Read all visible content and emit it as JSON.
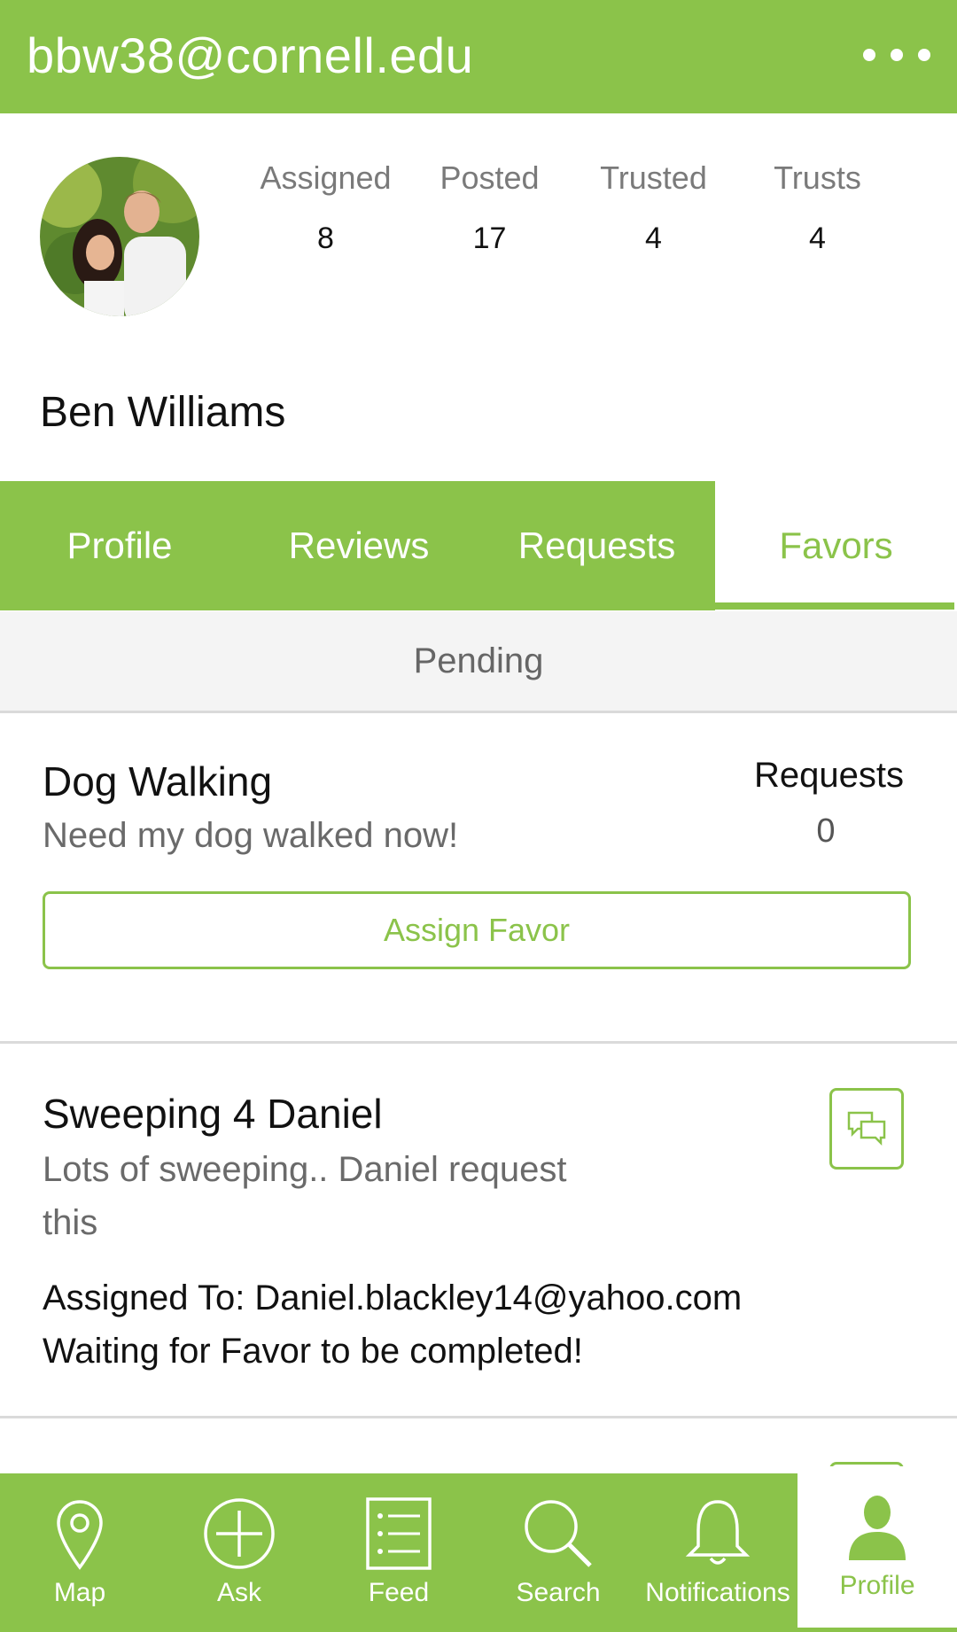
{
  "header": {
    "title": "bbw38@cornell.edu",
    "menu_icon": "more-dots-icon"
  },
  "profile": {
    "name": "Ben Williams",
    "stats": [
      {
        "label": "Assigned",
        "value": "8"
      },
      {
        "label": "Posted",
        "value": "17"
      },
      {
        "label": "Trusted",
        "value": "4"
      },
      {
        "label": "Trusts",
        "value": "4"
      }
    ]
  },
  "tabs": [
    {
      "label": "Profile"
    },
    {
      "label": "Reviews"
    },
    {
      "label": "Requests"
    },
    {
      "label": "Favors",
      "active": true
    }
  ],
  "section": {
    "title": "Pending"
  },
  "favors": [
    {
      "title": "Dog Walking",
      "description": "Need my dog walked now!",
      "requests_label": "Requests",
      "requests_count": "0",
      "button_label": "Assign Favor"
    },
    {
      "title": "Sweeping 4 Daniel",
      "description_line1": "Lots of sweeping.. Daniel request",
      "description_line2": "this",
      "assigned_to": "Assigned To: Daniel.blackley14@yahoo.com",
      "status": "Waiting for Favor to be completed!",
      "chat_icon": "chat-bubbles-icon"
    }
  ],
  "bottom_nav": [
    {
      "label": "Map",
      "icon": "map-pin-icon"
    },
    {
      "label": "Ask",
      "icon": "plus-circle-icon"
    },
    {
      "label": "Feed",
      "icon": "list-icon"
    },
    {
      "label": "Search",
      "icon": "search-icon"
    },
    {
      "label": "Notifications",
      "icon": "bell-icon"
    },
    {
      "label": "Profile",
      "icon": "person-icon",
      "active": true
    }
  ],
  "colors": {
    "accent": "#8bc34a",
    "background": "#ffffff",
    "divider": "#dadada"
  }
}
